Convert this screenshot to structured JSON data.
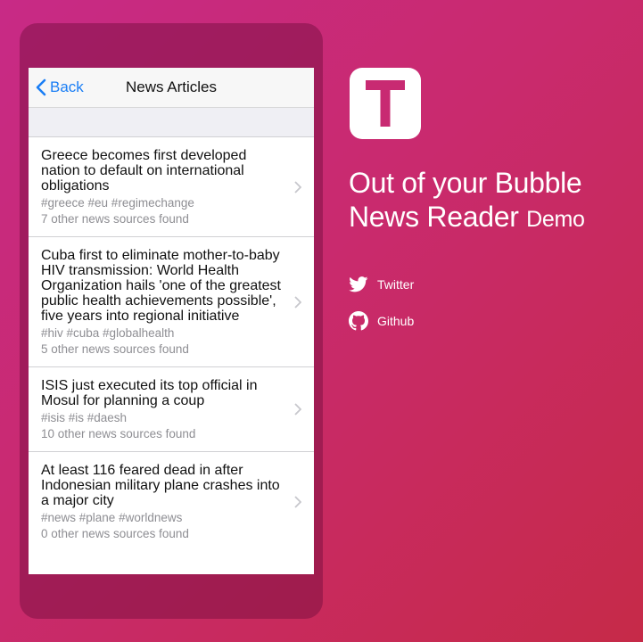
{
  "phone": {
    "nav": {
      "back_label": "Back",
      "title": "News Articles"
    },
    "articles": [
      {
        "title": "Greece becomes first developed nation to default on international obligations",
        "tags": "#greece #eu #regimechange",
        "sources": "7 other news sources found"
      },
      {
        "title": "Cuba first to eliminate mother-to-baby HIV transmission: World Health Organization hails 'one of the greatest public health achievements possible', five years into regional initiative",
        "tags": "#hiv #cuba #globalhealth",
        "sources": "5 other news sources found"
      },
      {
        "title": "ISIS just executed its top official in Mosul for planning a coup",
        "tags": "#isis #is #daesh",
        "sources": "10 other news sources found"
      },
      {
        "title": "At least 116 feared dead in after Indonesian military plane crashes into a major city",
        "tags": "#news #plane #worldnews",
        "sources": "0 other news sources found"
      }
    ]
  },
  "brand": {
    "icon_letter": "T",
    "headline_line1": "Out of your Bubble",
    "headline_line2": "News Reader",
    "headline_suffix": "Demo"
  },
  "links": {
    "twitter": "Twitter",
    "github": "Github"
  },
  "colors": {
    "accent": "#c82a72",
    "ios_blue": "#1a7ef5"
  }
}
